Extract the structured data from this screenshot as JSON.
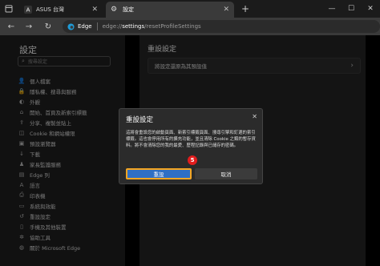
{
  "tabs": [
    {
      "label": "ASUS 台灣",
      "active": false
    },
    {
      "label": "設定",
      "active": true
    }
  ],
  "toolbar": {
    "brand": "Edge",
    "url_host": "edge://",
    "url_path": "settings",
    "url_rest": "/resetProfileSettings"
  },
  "sidebar": {
    "title": "設定",
    "search_placeholder": "搜尋設定",
    "items": [
      {
        "label": "個人檔案",
        "icon": "person-icon",
        "glyph": "👤"
      },
      {
        "label": "隱私權、搜尋與服務",
        "icon": "lock-icon",
        "glyph": "🔒"
      },
      {
        "label": "外觀",
        "icon": "palette-icon",
        "glyph": "◐"
      },
      {
        "label": "開始、首頁及新索引標籤",
        "icon": "home-icon",
        "glyph": "⌂"
      },
      {
        "label": "分享、複製並貼上",
        "icon": "share-icon",
        "glyph": "⇪"
      },
      {
        "label": "Cookie 和網站權限",
        "icon": "cookie-icon",
        "glyph": "◫"
      },
      {
        "label": "預設瀏覽器",
        "icon": "browser-icon",
        "glyph": "▣"
      },
      {
        "label": "下載",
        "icon": "download-icon",
        "glyph": "↓"
      },
      {
        "label": "家長監護服務",
        "icon": "family-icon",
        "glyph": "♟"
      },
      {
        "label": "Edge 列",
        "icon": "edge-bar-icon",
        "glyph": "▤"
      },
      {
        "label": "語言",
        "icon": "language-icon",
        "glyph": "A"
      },
      {
        "label": "印表機",
        "icon": "printer-icon",
        "glyph": "⎙"
      },
      {
        "label": "系統與效能",
        "icon": "system-icon",
        "glyph": "▭"
      },
      {
        "label": "重設設定",
        "icon": "reset-icon",
        "glyph": "↺"
      },
      {
        "label": "手機及其他裝置",
        "icon": "phone-icon",
        "glyph": "▯"
      },
      {
        "label": "協助工具",
        "icon": "accessibility-icon",
        "glyph": "✲"
      },
      {
        "label": "關於 Microsoft Edge",
        "icon": "edge-logo-icon",
        "glyph": "◍"
      }
    ]
  },
  "main": {
    "title": "重設設定",
    "reset_row_label": "將設定還原為其預設值"
  },
  "dialog": {
    "title": "重設設定",
    "body": "這將會重設您的啟動頁面、新索引標籤頁面、搜尋引擎和釘選的索引標籤。這也會停用所有的擴充功能，並且清除 Cookie 之類的暫存資料。將不會清除您的我的最愛、歷程記錄與已儲存的密碼。",
    "reset_label": "重設",
    "cancel_label": "取消",
    "step_number": "5"
  },
  "colors": {
    "accent": "#2f6fc4",
    "highlight_border": "#f5a623",
    "step_badge": "#e21d1d"
  }
}
